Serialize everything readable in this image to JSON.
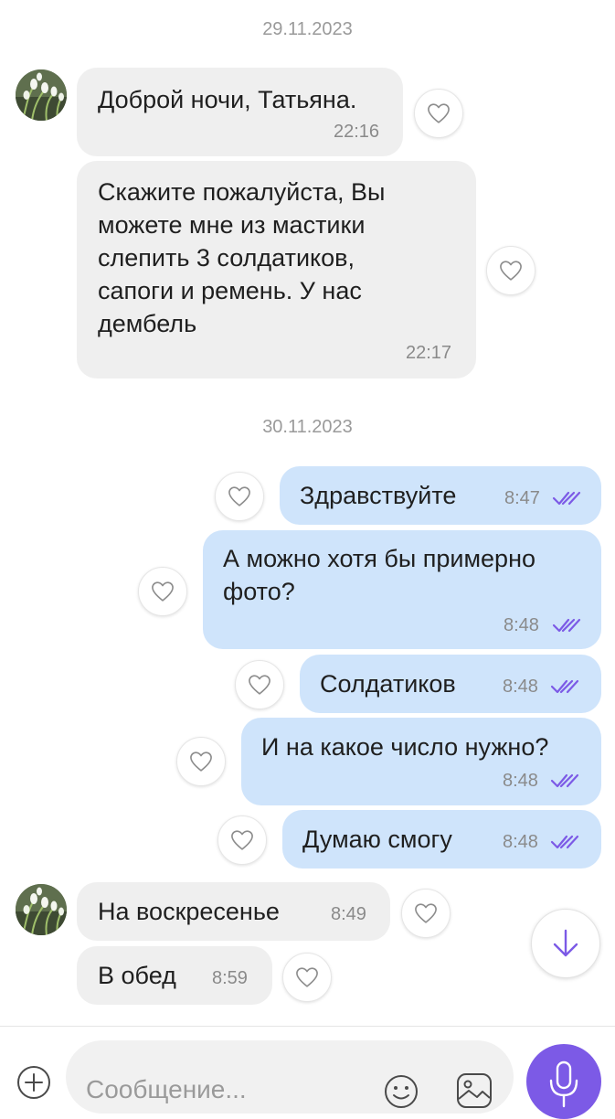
{
  "dates": [
    "29.11.2023",
    "30.11.2023"
  ],
  "messages_in_1": [
    {
      "text": "Доброй ночи, Татьяна.",
      "time": "22:16"
    },
    {
      "text": "Скажите пожалуйста, Вы\nможете мне из мастики\nслепить 3 солдатиков,\nсапоги и ремень. У нас\nдембель",
      "time": "22:17"
    }
  ],
  "messages_out": [
    {
      "text": "Здравствуйте",
      "time": "8:47"
    },
    {
      "text": "А можно хотя бы примерно\nфото?",
      "time": "8:48"
    },
    {
      "text": "Солдатиков",
      "time": "8:48"
    },
    {
      "text": "И на какое число нужно?",
      "time": "8:48"
    },
    {
      "text": "Думаю смогу",
      "time": "8:48"
    }
  ],
  "messages_in_2": [
    {
      "text": "На воскресенье",
      "time": "8:49"
    },
    {
      "text": "В обед",
      "time": "8:59"
    }
  ],
  "composer": {
    "placeholder": "Сообщение..."
  },
  "icons": {
    "like": "heart-icon",
    "read_status": "double-check-icon",
    "scroll": "arrow-down-icon",
    "attach": "plus-icon",
    "emoji": "smiley-icon",
    "gallery": "image-icon",
    "voice": "microphone-icon"
  },
  "colors": {
    "incoming_bubble": "#efefef",
    "outgoing_bubble": "#cfe4fb",
    "accent": "#7c5ae6",
    "ticks": "#7c5ae6"
  }
}
